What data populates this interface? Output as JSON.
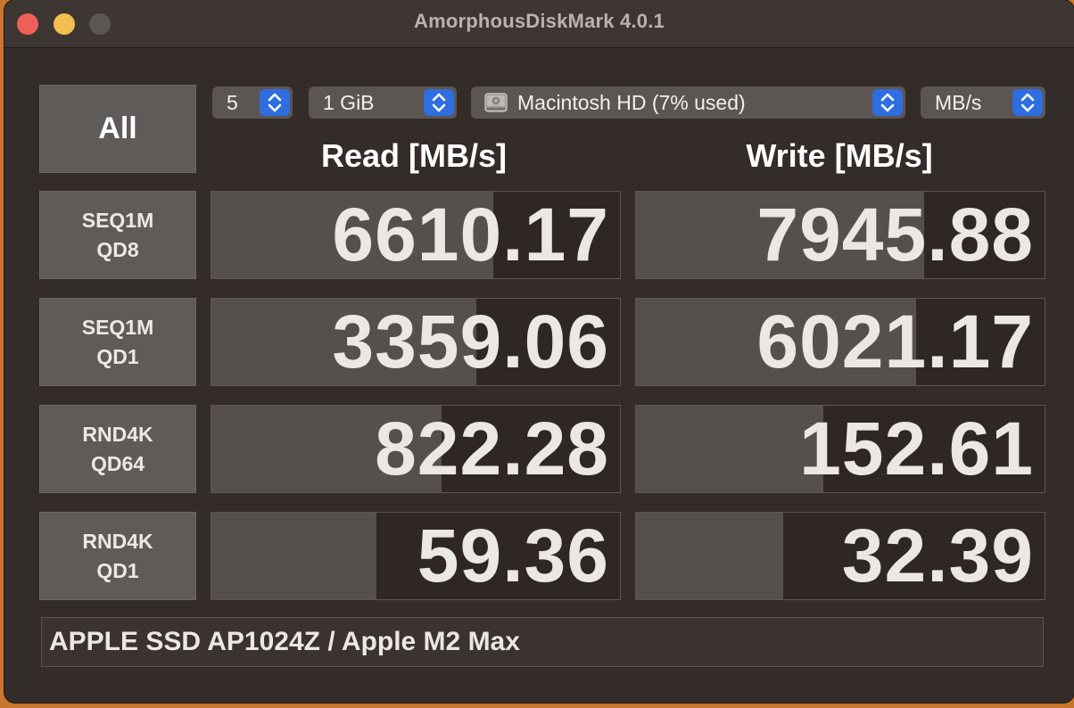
{
  "window": {
    "title": "AmorphousDiskMark 4.0.1"
  },
  "controls": {
    "all_label": "All",
    "count": "5",
    "size": "1 GiB",
    "disk": "Macintosh HD (7% used)",
    "unit": "MB/s"
  },
  "headers": {
    "read": "Read [MB/s]",
    "write": "Write [MB/s]"
  },
  "rows": [
    {
      "line1": "SEQ1M",
      "line2": "QD8",
      "read": "6610.17",
      "write": "7945.88",
      "read_fill": 0.69,
      "write_fill": 0.705
    },
    {
      "line1": "SEQ1M",
      "line2": "QD1",
      "read": "3359.06",
      "write": "6021.17",
      "read_fill": 0.648,
      "write_fill": 0.686
    },
    {
      "line1": "RND4K",
      "line2": "QD64",
      "read": "822.28",
      "write": "152.61",
      "read_fill": 0.563,
      "write_fill": 0.458
    },
    {
      "line1": "RND4K",
      "line2": "QD1",
      "read": "59.36",
      "write": "32.39",
      "read_fill": 0.403,
      "write_fill": 0.361
    }
  ],
  "footer": {
    "device": "APPLE SSD AP1024Z / Apple M2 Max"
  },
  "colors": {
    "accent": "#2e6ee0",
    "bar": "#56504d",
    "cell_bg": "#2f2725"
  },
  "icons": {
    "disk": "hard-drive-icon",
    "chevron": "chevron-up-down-icon"
  }
}
